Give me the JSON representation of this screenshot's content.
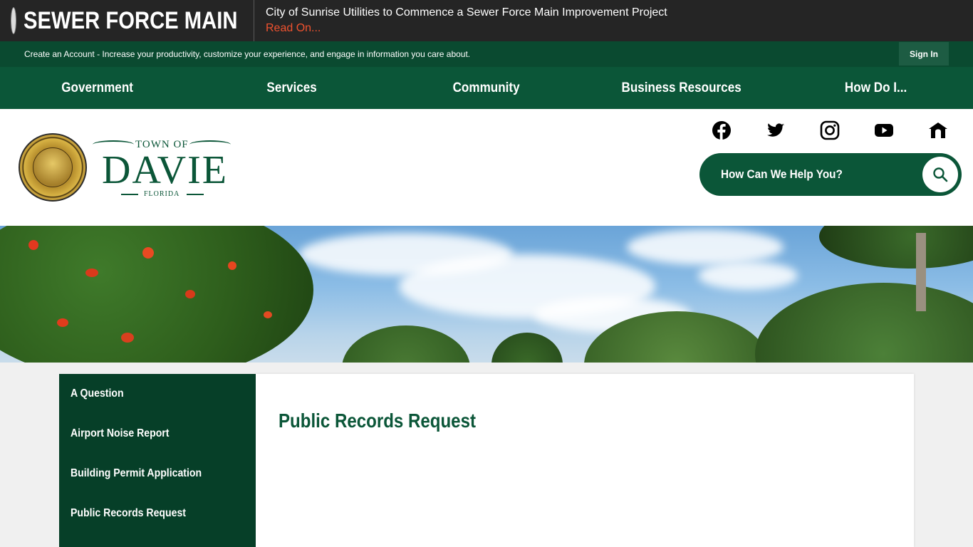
{
  "alert": {
    "title": "SEWER FORCE MAIN",
    "message": "City of Sunrise Utilities to Commence a Sewer Force Main Improvement Project",
    "link": "Read On..."
  },
  "account": {
    "text": "Create an Account - Increase your productivity, customize your experience, and engage in information you care about.",
    "signin": "Sign In"
  },
  "nav": {
    "items": [
      "Government",
      "Services",
      "Community",
      "Business Resources",
      "How Do I..."
    ]
  },
  "logo": {
    "town_of": "TOWN OF",
    "name": "DAVIE",
    "state": "FLORIDA"
  },
  "social": [
    "facebook-icon",
    "twitter-icon",
    "instagram-icon",
    "youtube-icon",
    "nextdoor-icon"
  ],
  "search": {
    "placeholder": "How Can We Help You?"
  },
  "sidebar": {
    "items": [
      {
        "label": "A Question"
      },
      {
        "label": "Airport Noise Report"
      },
      {
        "label": "Building Permit Application"
      },
      {
        "label": "Public Records Request"
      }
    ]
  },
  "main": {
    "title": "Public Records Request"
  },
  "colors": {
    "dark_green": "#063f28",
    "green": "#0b5638",
    "alert_bg": "#252525",
    "link_orange": "#f0522f"
  }
}
